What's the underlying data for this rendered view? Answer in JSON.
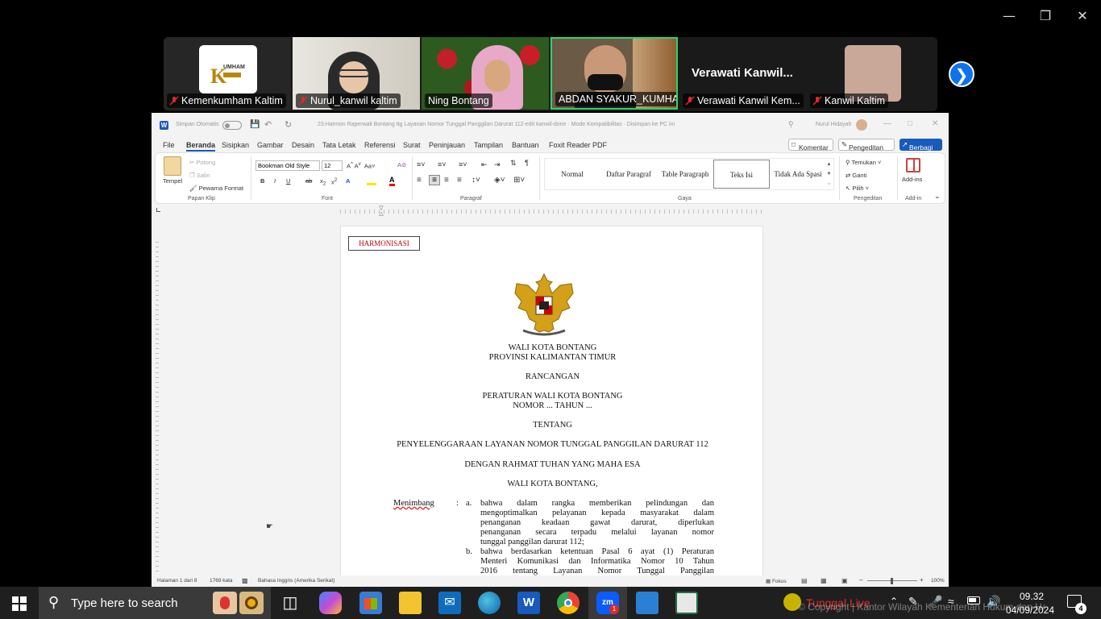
{
  "gallery": {
    "participants": [
      {
        "name": "Kemenkumham Kaltim",
        "logo_text": "UMHAM"
      },
      {
        "name": "Nurul_kanwil kaltim"
      },
      {
        "name": "Ning Bontang"
      },
      {
        "name": "ABDAN SYAKUR_KUMHA..."
      },
      {
        "name": "Verawati Kanwil Kem...",
        "big_name": "Verawati  Kanwil..."
      },
      {
        "name": "Kanwil Kaltim"
      }
    ]
  },
  "word": {
    "title": "23.Harmon Raperwali Bontang ttg Layanan Nomor Tunggal Panggilan Darurat 112-edit kanwil-done  ·  Mode Kompatibilitas  ·  Disimpan ke PC ini",
    "autosave": "Simpan Otomatis",
    "user": "Nurul Hidayah",
    "menu": [
      "File",
      "Beranda",
      "Sisipkan",
      "Gambar",
      "Desain",
      "Tata Letak",
      "Referensi",
      "Surat",
      "Peninjauan",
      "Tampilan",
      "Bantuan",
      "Foxit Reader PDF"
    ],
    "komentar": "Komentar",
    "pengeditan": "Pengeditan",
    "berbagi": "Berbagi",
    "ribbon": {
      "tempel": "Tempel",
      "potong": "Potong",
      "salin": "Salin",
      "pewarna": "Pewarna Format",
      "papan_klip": "Papan Klip",
      "font_name": "Bookman Old Style",
      "font_size": "12",
      "font": "Font",
      "paragraf": "Paragraf",
      "gaya": "Gaya",
      "styles": [
        "Normal",
        "Daftar Paragraf",
        "Table Paragraph",
        "Teks Isi",
        "Tidak Ada Spasi"
      ],
      "temukan": "Temukan",
      "ganti": "Ganti",
      "pilih": "Pilih",
      "pengeditan": "Pengeditan",
      "addins": "Add-ins",
      "addin": "Add-in"
    },
    "document": {
      "stamp": "HARMONISASI",
      "lines": [
        "WALI KOTA BONTANG",
        "PROVINSI KALIMANTAN TIMUR",
        "RANCANGAN",
        "PERATURAN WALI KOTA BONTANG",
        "NOMOR ... TAHUN ...",
        "TENTANG",
        "PENYELENGGARAAN LAYANAN NOMOR TUNGGAL PANGGILAN DARURAT 112",
        "DENGAN RAHMAT TUHAN YANG MAHA ESA",
        "WALI KOTA BONTANG,"
      ],
      "menimbang": "Menimbang",
      "colon": ":",
      "a_label": "a.",
      "a_lines": [
        "bahwa dalam rangka memberikan pelindungan dan",
        "mengoptimalkan pelayanan kepada masyarakat dalam",
        "penanganan keadaan gawat darurat, diperlukan",
        "penanganan secara terpadu melalui layanan nomor",
        "tunggal panggilan darurat 112;"
      ],
      "b_label": "b.",
      "b_lines": [
        "bahwa berdasarkan ketentuan Pasal 6 ayat (1) Peraturan",
        "Menteri Komunikasi dan Informatika Nomor 10 Tahun",
        "2016 tentang Layanan Nomor Tunggal Panggilan"
      ]
    },
    "status": {
      "page": "Halaman 1 dari 8",
      "words": "1769 kata",
      "lang": "Bahasa Inggris (Amerika Serikat)",
      "focus": "Fokus",
      "zoom": "100%"
    }
  },
  "taskbar": {
    "search_placeholder": "Type here to search",
    "live_text": "Tunggal Live",
    "ticker": "© Copyright | Kantor Wilayah Kementerian Hukum dan HAM Kalimantan Timur",
    "time": "09.32",
    "date": "04/09/2024",
    "notif_count": "4",
    "zoom_badge": "1"
  },
  "colors": {
    "accent": "#0e72ed",
    "word_blue": "#185abd",
    "stamp_red": "#c00000"
  }
}
